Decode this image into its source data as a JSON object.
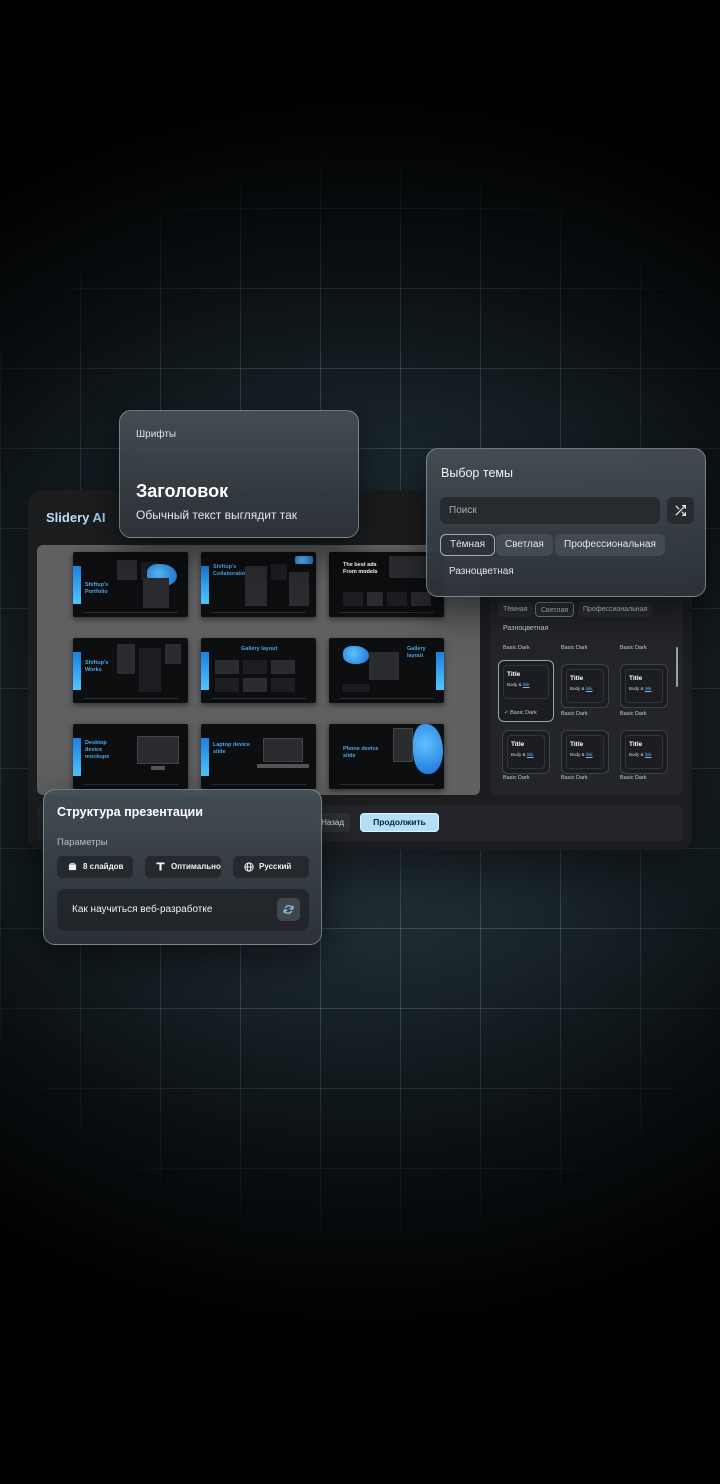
{
  "app": {
    "logo_first": "Slidery",
    "logo_second": "AI"
  },
  "fonts_panel": {
    "label": "Шрифты",
    "heading_sample": "Заголовок",
    "body_sample": "Обычный текст выглядит так"
  },
  "theme_select": {
    "title": "Выбор темы",
    "search_placeholder": "Поиск",
    "chips": [
      {
        "label": "Тёмная",
        "active": true
      },
      {
        "label": "Светлая",
        "active": false
      },
      {
        "label": "Профессиональная",
        "active": false
      },
      {
        "label": "Разноцветная",
        "active": false
      }
    ]
  },
  "slides": [
    {
      "title": "Shiftup's Portfolio"
    },
    {
      "title": "Shiftup's Collaborations"
    },
    {
      "title": "The best ads From models"
    },
    {
      "title": "Shiftup's Works"
    },
    {
      "title": "Gallery layout"
    },
    {
      "title": "Gallery layout"
    },
    {
      "title": "Desktop device mockups"
    },
    {
      "title": "Laptop device slide"
    },
    {
      "title": "Phone device slide"
    }
  ],
  "theme_panel": {
    "chips": [
      "Тёмная",
      "Светлая",
      "Профессиональная",
      "Разноцветная"
    ],
    "row1_labels": [
      "Basic Dark",
      "Basic Dark",
      "Basic Dark"
    ],
    "card_title": "Title",
    "card_body": "Body &",
    "card_link": "link",
    "selected_label": "Basic Dark",
    "row2_labels": [
      "Basic Dark",
      "Basic Dark"
    ],
    "row3_labels": [
      "Basic Dark",
      "Basic Dark",
      "Basic Dark"
    ]
  },
  "bottom_bar": {
    "back_label": "Назад",
    "continue_label": "Продолжить"
  },
  "structure_panel": {
    "title": "Структура презентации",
    "params_label": "Параметры",
    "chips": [
      {
        "icon": "slides-icon",
        "label": "8 слайдов"
      },
      {
        "icon": "text-icon",
        "label": "Оптимально"
      },
      {
        "icon": "globe-icon",
        "label": "Русский"
      }
    ],
    "topic": "Как научиться веб-разработке"
  },
  "colors": {
    "accent": "#b2e0f6",
    "slide_accent": "#49a9ec"
  }
}
